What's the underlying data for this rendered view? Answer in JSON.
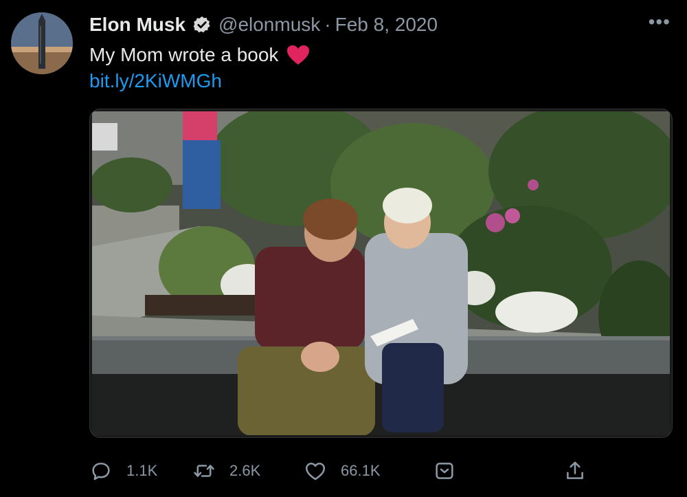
{
  "tweet": {
    "author_name": "Elon Musk",
    "handle": "@elonmusk",
    "separator": "·",
    "date": "Feb 8, 2020",
    "more_label": "•••",
    "text": "My Mom wrote a book",
    "link_text": "bit.ly/2KiWMGh"
  },
  "actions": {
    "reply_count": "1.1K",
    "retweet_count": "2.6K",
    "like_count": "66.1K"
  },
  "colors": {
    "background": "#000000",
    "text_primary": "#e7e9ea",
    "text_secondary": "#8b98a5",
    "link": "#1d9bf0",
    "heart": "#e0245e"
  },
  "icons": {
    "verified": "verified-badge-icon",
    "heart_emoji": "red-heart-emoji",
    "reply": "reply-icon",
    "retweet": "retweet-icon",
    "like": "like-heart-icon",
    "bookmark": "bookmark-icon",
    "share": "share-icon"
  }
}
